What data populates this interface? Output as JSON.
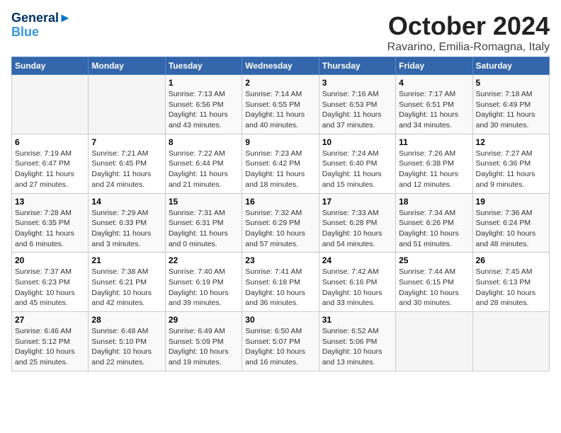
{
  "header": {
    "logo_line1": "General",
    "logo_line2": "Blue",
    "title": "October 2024",
    "location": "Ravarino, Emilia-Romagna, Italy"
  },
  "weekdays": [
    "Sunday",
    "Monday",
    "Tuesday",
    "Wednesday",
    "Thursday",
    "Friday",
    "Saturday"
  ],
  "weeks": [
    [
      null,
      null,
      {
        "day": "1",
        "sunrise": "Sunrise: 7:13 AM",
        "sunset": "Sunset: 6:56 PM",
        "daylight": "Daylight: 11 hours and 43 minutes."
      },
      {
        "day": "2",
        "sunrise": "Sunrise: 7:14 AM",
        "sunset": "Sunset: 6:55 PM",
        "daylight": "Daylight: 11 hours and 40 minutes."
      },
      {
        "day": "3",
        "sunrise": "Sunrise: 7:16 AM",
        "sunset": "Sunset: 6:53 PM",
        "daylight": "Daylight: 11 hours and 37 minutes."
      },
      {
        "day": "4",
        "sunrise": "Sunrise: 7:17 AM",
        "sunset": "Sunset: 6:51 PM",
        "daylight": "Daylight: 11 hours and 34 minutes."
      },
      {
        "day": "5",
        "sunrise": "Sunrise: 7:18 AM",
        "sunset": "Sunset: 6:49 PM",
        "daylight": "Daylight: 11 hours and 30 minutes."
      }
    ],
    [
      {
        "day": "6",
        "sunrise": "Sunrise: 7:19 AM",
        "sunset": "Sunset: 6:47 PM",
        "daylight": "Daylight: 11 hours and 27 minutes."
      },
      {
        "day": "7",
        "sunrise": "Sunrise: 7:21 AM",
        "sunset": "Sunset: 6:45 PM",
        "daylight": "Daylight: 11 hours and 24 minutes."
      },
      {
        "day": "8",
        "sunrise": "Sunrise: 7:22 AM",
        "sunset": "Sunset: 6:44 PM",
        "daylight": "Daylight: 11 hours and 21 minutes."
      },
      {
        "day": "9",
        "sunrise": "Sunrise: 7:23 AM",
        "sunset": "Sunset: 6:42 PM",
        "daylight": "Daylight: 11 hours and 18 minutes."
      },
      {
        "day": "10",
        "sunrise": "Sunrise: 7:24 AM",
        "sunset": "Sunset: 6:40 PM",
        "daylight": "Daylight: 11 hours and 15 minutes."
      },
      {
        "day": "11",
        "sunrise": "Sunrise: 7:26 AM",
        "sunset": "Sunset: 6:38 PM",
        "daylight": "Daylight: 11 hours and 12 minutes."
      },
      {
        "day": "12",
        "sunrise": "Sunrise: 7:27 AM",
        "sunset": "Sunset: 6:36 PM",
        "daylight": "Daylight: 11 hours and 9 minutes."
      }
    ],
    [
      {
        "day": "13",
        "sunrise": "Sunrise: 7:28 AM",
        "sunset": "Sunset: 6:35 PM",
        "daylight": "Daylight: 11 hours and 6 minutes."
      },
      {
        "day": "14",
        "sunrise": "Sunrise: 7:29 AM",
        "sunset": "Sunset: 6:33 PM",
        "daylight": "Daylight: 11 hours and 3 minutes."
      },
      {
        "day": "15",
        "sunrise": "Sunrise: 7:31 AM",
        "sunset": "Sunset: 6:31 PM",
        "daylight": "Daylight: 11 hours and 0 minutes."
      },
      {
        "day": "16",
        "sunrise": "Sunrise: 7:32 AM",
        "sunset": "Sunset: 6:29 PM",
        "daylight": "Daylight: 10 hours and 57 minutes."
      },
      {
        "day": "17",
        "sunrise": "Sunrise: 7:33 AM",
        "sunset": "Sunset: 6:28 PM",
        "daylight": "Daylight: 10 hours and 54 minutes."
      },
      {
        "day": "18",
        "sunrise": "Sunrise: 7:34 AM",
        "sunset": "Sunset: 6:26 PM",
        "daylight": "Daylight: 10 hours and 51 minutes."
      },
      {
        "day": "19",
        "sunrise": "Sunrise: 7:36 AM",
        "sunset": "Sunset: 6:24 PM",
        "daylight": "Daylight: 10 hours and 48 minutes."
      }
    ],
    [
      {
        "day": "20",
        "sunrise": "Sunrise: 7:37 AM",
        "sunset": "Sunset: 6:23 PM",
        "daylight": "Daylight: 10 hours and 45 minutes."
      },
      {
        "day": "21",
        "sunrise": "Sunrise: 7:38 AM",
        "sunset": "Sunset: 6:21 PM",
        "daylight": "Daylight: 10 hours and 42 minutes."
      },
      {
        "day": "22",
        "sunrise": "Sunrise: 7:40 AM",
        "sunset": "Sunset: 6:19 PM",
        "daylight": "Daylight: 10 hours and 39 minutes."
      },
      {
        "day": "23",
        "sunrise": "Sunrise: 7:41 AM",
        "sunset": "Sunset: 6:18 PM",
        "daylight": "Daylight: 10 hours and 36 minutes."
      },
      {
        "day": "24",
        "sunrise": "Sunrise: 7:42 AM",
        "sunset": "Sunset: 6:16 PM",
        "daylight": "Daylight: 10 hours and 33 minutes."
      },
      {
        "day": "25",
        "sunrise": "Sunrise: 7:44 AM",
        "sunset": "Sunset: 6:15 PM",
        "daylight": "Daylight: 10 hours and 30 minutes."
      },
      {
        "day": "26",
        "sunrise": "Sunrise: 7:45 AM",
        "sunset": "Sunset: 6:13 PM",
        "daylight": "Daylight: 10 hours and 28 minutes."
      }
    ],
    [
      {
        "day": "27",
        "sunrise": "Sunrise: 6:46 AM",
        "sunset": "Sunset: 5:12 PM",
        "daylight": "Daylight: 10 hours and 25 minutes."
      },
      {
        "day": "28",
        "sunrise": "Sunrise: 6:48 AM",
        "sunset": "Sunset: 5:10 PM",
        "daylight": "Daylight: 10 hours and 22 minutes."
      },
      {
        "day": "29",
        "sunrise": "Sunrise: 6:49 AM",
        "sunset": "Sunset: 5:09 PM",
        "daylight": "Daylight: 10 hours and 19 minutes."
      },
      {
        "day": "30",
        "sunrise": "Sunrise: 6:50 AM",
        "sunset": "Sunset: 5:07 PM",
        "daylight": "Daylight: 10 hours and 16 minutes."
      },
      {
        "day": "31",
        "sunrise": "Sunrise: 6:52 AM",
        "sunset": "Sunset: 5:06 PM",
        "daylight": "Daylight: 10 hours and 13 minutes."
      },
      null,
      null
    ]
  ]
}
